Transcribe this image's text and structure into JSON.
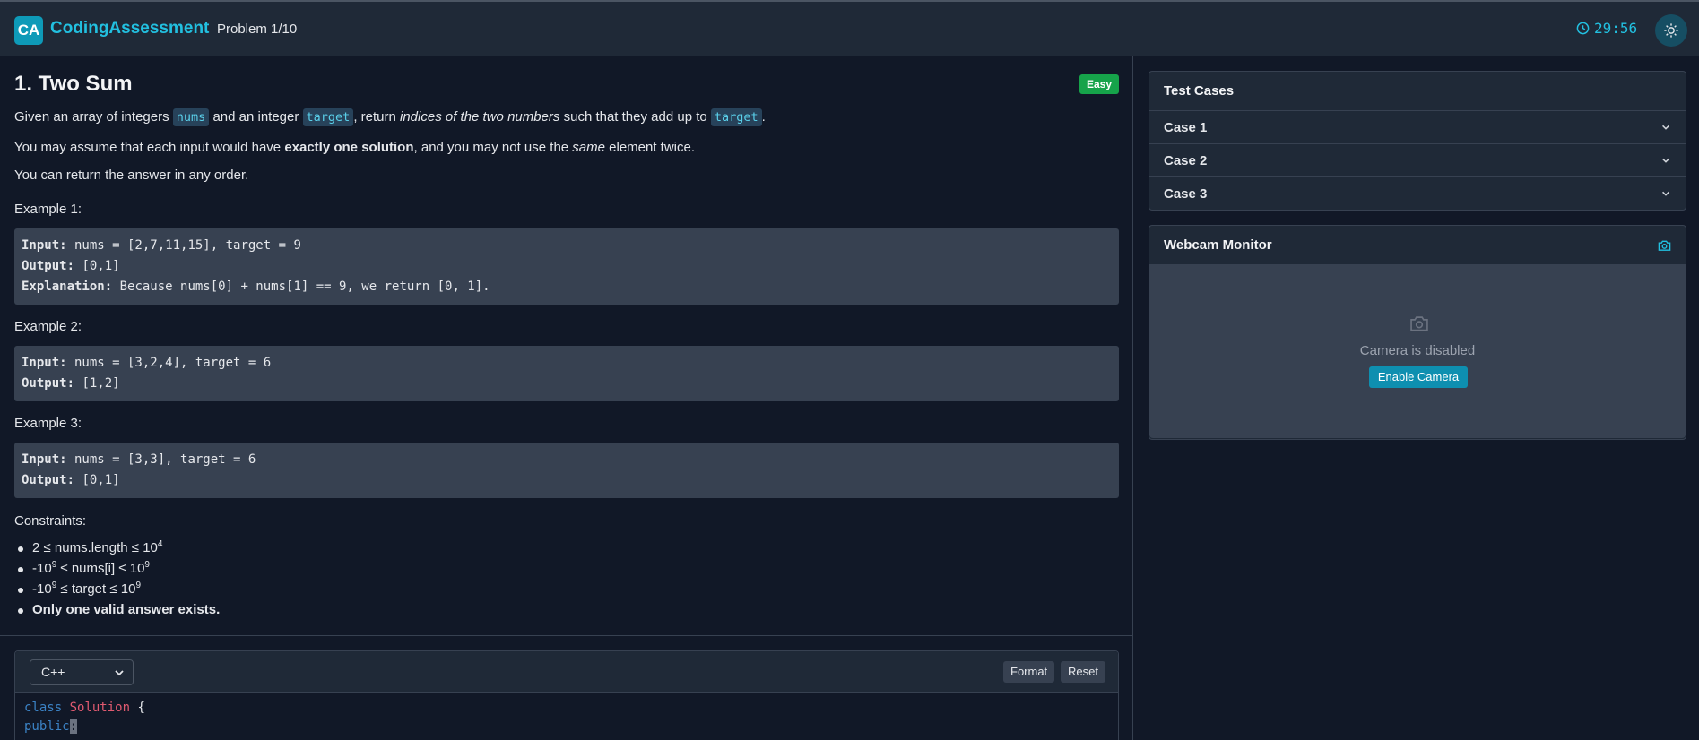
{
  "header": {
    "logo_text": "CA",
    "app_title": "CodingAssessment",
    "progress": "Problem 1/10",
    "timer": "29:56"
  },
  "problem": {
    "title": "1. Two Sum",
    "difficulty": "Easy",
    "desc1": {
      "a": "Given an array of integers ",
      "nums": "nums",
      "b": " and an integer ",
      "target": "target",
      "c": ", return ",
      "em": "indices of the two numbers",
      "d": " such that they add up to ",
      "target2": "target",
      "e": "."
    },
    "desc2": {
      "a": "You may assume that each input would have ",
      "strong": "exactly one solution",
      "b": ", and you may not use the ",
      "em": "same",
      "c": " element twice."
    },
    "desc3": "You can return the answer in any order.",
    "examples": [
      {
        "title": "Example 1:",
        "input_label": "Input:",
        "input": " nums = [2,7,11,15], target = 9",
        "output_label": "Output:",
        "output": " [0,1]",
        "expl_label": "Explanation:",
        "expl": " Because nums[0] + nums[1] == 9, we return [0, 1]."
      },
      {
        "title": "Example 2:",
        "input_label": "Input:",
        "input": " nums = [3,2,4], target = 6",
        "output_label": "Output:",
        "output": " [1,2]"
      },
      {
        "title": "Example 3:",
        "input_label": "Input:",
        "input": " nums = [3,3], target = 6",
        "output_label": "Output:",
        "output": " [0,1]"
      }
    ],
    "constraints_title": "Constraints:",
    "constraints": [
      {
        "pre": "2 ≤ nums.length ≤ 10",
        "sup": "4"
      },
      {
        "pre": "-10",
        "sup1": "9",
        "mid": " ≤ nums[i] ≤ 10",
        "sup2": "9"
      },
      {
        "pre": "-10",
        "sup1": "9",
        "mid": " ≤ target ≤ 10",
        "sup2": "9"
      },
      {
        "strong": "Only one valid answer exists."
      }
    ]
  },
  "editor": {
    "language": "C++",
    "format_label": "Format",
    "reset_label": "Reset",
    "line1": {
      "kw": "class",
      "cls": "Solution",
      "rest": " {"
    },
    "line2": {
      "kw": "public",
      "cursor": ":"
    }
  },
  "test_cases": {
    "title": "Test Cases",
    "cases": [
      "Case 1",
      "Case 2",
      "Case 3"
    ]
  },
  "webcam": {
    "title": "Webcam Monitor",
    "status": "Camera is disabled",
    "enable_label": "Enable Camera"
  },
  "colors": {
    "accent": "#22c0e0",
    "easy_badge": "#16a34a",
    "background": "#111827",
    "panel": "#1f2937"
  }
}
